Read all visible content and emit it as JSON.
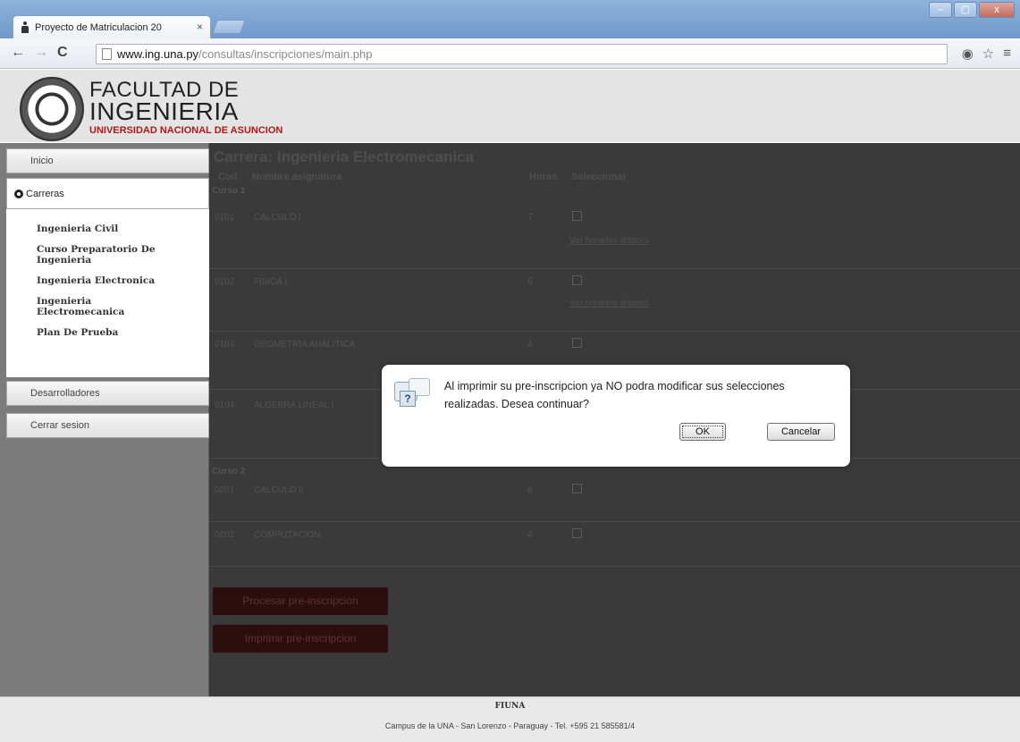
{
  "browser": {
    "tab_title": "Proyecto de Matriculacion 20",
    "tab_close": "×",
    "url_host": "www.ing.una.py",
    "url_path": "/consultas/inscripciones/main.php",
    "window_controls": [
      "–",
      "▢",
      "x"
    ]
  },
  "header": {
    "logo_line1": "FACULTAD DE",
    "logo_line2": "INGENIERIA",
    "logo_line3": "UNIVERSIDAD NACIONAL DE ASUNCION"
  },
  "sidebar": {
    "inicio": "Inicio",
    "carreras": "Carreras",
    "carreras_items": [
      "Ingenieria Civil",
      "Curso Preparatorio De Ingenieria",
      "Ingenieria Electronica",
      "Ingenieria Electromecanica",
      "Plan De Prueba"
    ],
    "desarrolladores": "Desarrolladores",
    "cerrar_sesion": "Cerrar sesion"
  },
  "content": {
    "title": "Carrera: Ingenieria Electromecanica",
    "col_code": "Cod.",
    "col_name": "Nombre asignatura",
    "col_hours": "Horas",
    "col_select": "Seleccionar",
    "semester1": "Curso 1",
    "semester2": "Curso 2",
    "rows": [
      {
        "code": "0101",
        "name": "CALCULO I",
        "hours": "7",
        "link": "Ver horarios disponi"
      },
      {
        "code": "0102",
        "name": "FISICA I",
        "hours": "6",
        "link": "Ver horarios disponi"
      },
      {
        "code": "0103",
        "name": "GEOMETRIA ANALITICA",
        "hours": "4",
        "link": ""
      },
      {
        "code": "0104",
        "name": "ALGEBRA LINEAL I",
        "hours": "",
        "link": ""
      },
      {
        "code": "0201",
        "name": "CALCULO II",
        "hours": "6",
        "link": ""
      },
      {
        "code": "0202",
        "name": "COMPUTACION",
        "hours": "4",
        "link": ""
      }
    ],
    "btn_process": "Procesar pre-inscripcion",
    "btn_print": "Imprimir pre-inscripcion"
  },
  "footer": {
    "line1": "FIUNA",
    "line2": "Campus de la UNA - San Lorenzo - Paraguay - Tel. +595 21 585581/4"
  },
  "dialog": {
    "message": "Al imprimir su pre-inscripcion ya NO podra modificar sus selecciones realizadas. Desea continuar?",
    "ok": "OK",
    "cancel": "Cancelar"
  },
  "icons": {
    "back": "back-arrow-icon",
    "forward": "forward-arrow-icon",
    "reload": "reload-icon",
    "page": "page-icon",
    "eye": "eye-icon",
    "star": "star-icon",
    "menu": "menu-icon",
    "question": "question-icon"
  },
  "colors": {
    "brand_red": "#b01818",
    "overlay": "#3a3a3a",
    "titlebar": "#7aa2d1"
  }
}
